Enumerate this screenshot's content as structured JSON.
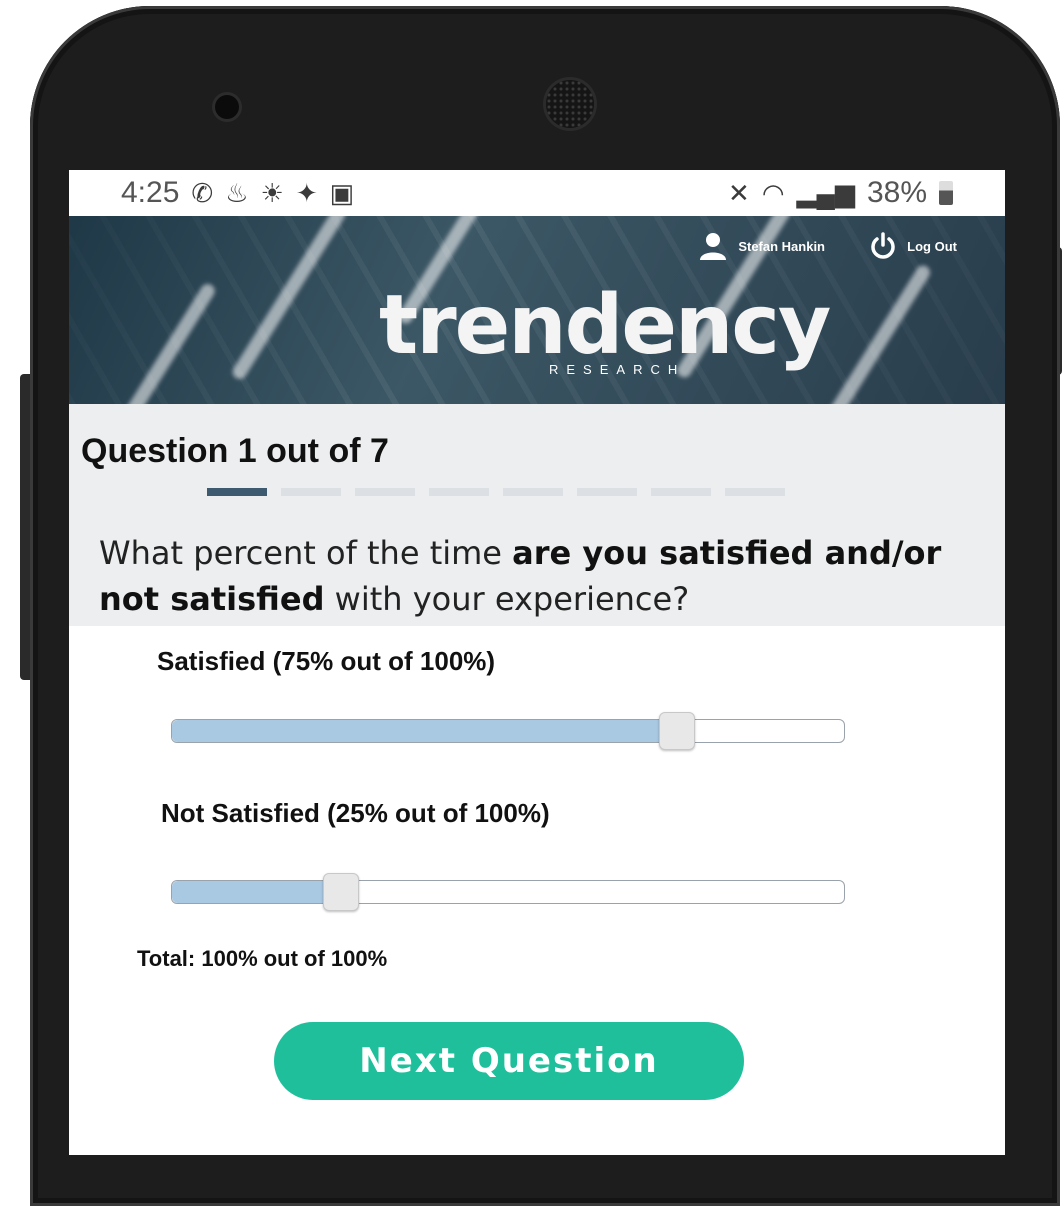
{
  "status_bar": {
    "time": "4:25",
    "battery_percent": "38%",
    "left_icons": [
      "whatsapp-icon",
      "notification-icon",
      "weather-icon",
      "twitter-icon",
      "gallery-icon"
    ],
    "right_icons": [
      "mute-icon",
      "wifi-icon",
      "signal-icon",
      "battery-icon"
    ]
  },
  "header": {
    "user_name": "Stefan Hankin",
    "logout_label": "Log Out",
    "logo_text": "trendency",
    "logo_subtext": "RESEARCH"
  },
  "question": {
    "counter": "Question 1 out of 7",
    "progress_total": 8,
    "progress_current": 1,
    "text_part1": "What percent of the time ",
    "text_bold": "are you satisfied and/or not satisfied",
    "text_part2": " with your experience?"
  },
  "sliders": [
    {
      "label": "Satisfied (75% out of 100%)",
      "value": 75
    },
    {
      "label": "Not Satisfied (25% out of 100%)",
      "value": 25
    }
  ],
  "total_text": "Total: 100% out of 100%",
  "next_button_label": "Next Question",
  "colors": {
    "accent": "#1fbf9c",
    "progress_active": "#3d5a70",
    "slider_fill": "#a9c8e2"
  }
}
